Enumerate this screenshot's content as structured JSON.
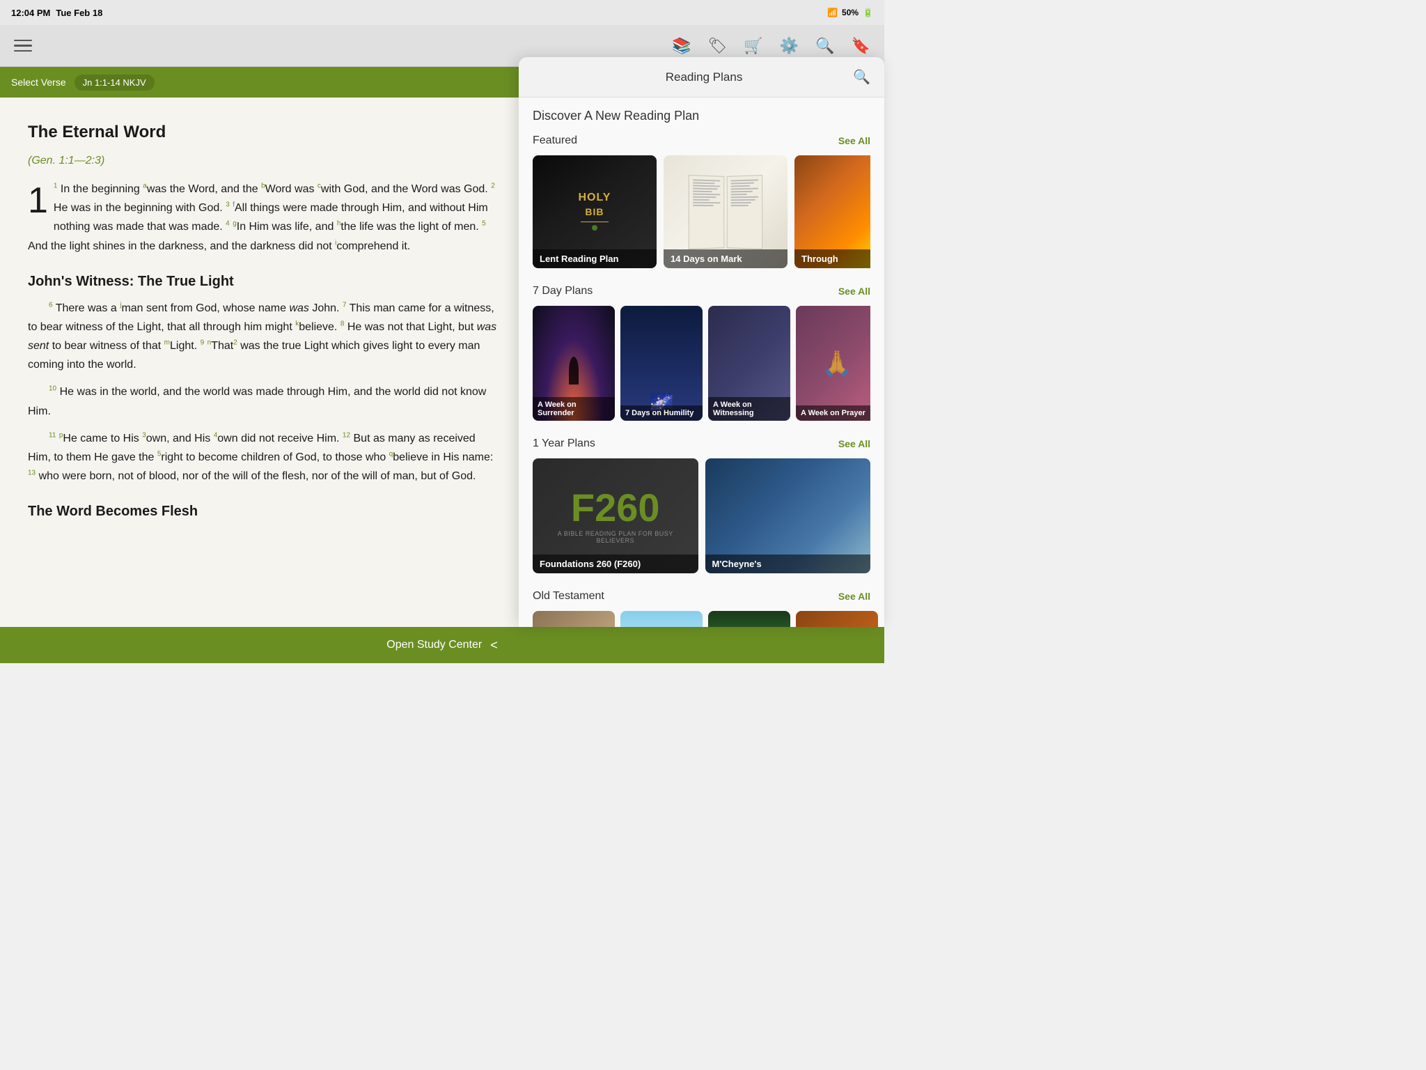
{
  "statusBar": {
    "time": "12:04 PM",
    "date": "Tue Feb 18",
    "wifi": "WiFi",
    "battery": "50%"
  },
  "toolbar": {
    "hamburger": "menu",
    "icons": [
      "bookshelf-icon",
      "bookmark-flag-icon",
      "cart-icon",
      "settings-icon",
      "search-icon",
      "bookmark-icon"
    ]
  },
  "bibleToolbar": {
    "selectVerse": "Select Verse",
    "verseRef": "Jn 1:1-14 NKJV"
  },
  "bibleContent": {
    "title": "The Eternal Word",
    "crossRef": "(Gen. 1:1—2:3)",
    "section2": "John's Witness: The True Light",
    "section3": "The Word Becomes Flesh"
  },
  "bottomBar": {
    "label": "Open Study Center",
    "chevron": "<"
  },
  "readingPlans": {
    "panelTitle": "Reading Plans",
    "discoverTitle": "Discover A New Reading Plan",
    "featured": {
      "sectionLabel": "Featured",
      "seeAll": "See All",
      "cards": [
        {
          "label": "Lent Reading Plan"
        },
        {
          "label": "14 Days on Mark"
        },
        {
          "label": "Through"
        }
      ]
    },
    "sevenDay": {
      "sectionLabel": "7 Day Plans",
      "seeAll": "See All",
      "cards": [
        {
          "label": "A Week on Surrender"
        },
        {
          "label": "7 Days on Humility"
        },
        {
          "label": "A Week on Witnessing"
        },
        {
          "label": "A Week on Prayer"
        }
      ]
    },
    "oneYear": {
      "sectionLabel": "1 Year Plans",
      "seeAll": "See All",
      "cards": [
        {
          "label": "Foundations 260 (F260)"
        },
        {
          "label": "M'Cheyne's"
        }
      ]
    },
    "oldTestament": {
      "sectionLabel": "Old Testament",
      "seeAll": "See All",
      "cards": [
        {
          "label": ""
        },
        {
          "label": ""
        },
        {
          "label": ""
        },
        {
          "label": ""
        }
      ]
    }
  }
}
